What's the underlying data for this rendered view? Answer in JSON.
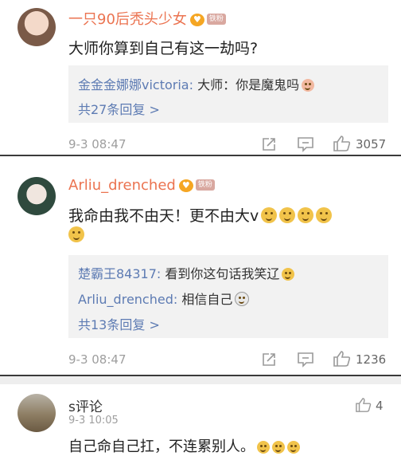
{
  "comments": [
    {
      "name": "一只90后秃头少女",
      "badge": "铁粉",
      "text": "大师你算到自己有这一劫吗?",
      "replies": [
        {
          "name": "金金金娜娜victoria:",
          "text": " 大师：你是魔鬼吗"
        }
      ],
      "more": "共27条回复 >",
      "time": "9-3 08:47",
      "likes": "3057"
    },
    {
      "name": "Arliu_drenched",
      "badge": "铁粉",
      "text_line1": "我命由我不由天！更不由大v",
      "text_line2": "",
      "replies": [
        {
          "name": "楚霸王84317:",
          "text": " 看到你这句话我笑辽"
        },
        {
          "name": "Arliu_drenched:",
          "text": " 相信自己"
        }
      ],
      "more": "共13条回复 >",
      "time": "9-3 08:47",
      "likes": "1236"
    },
    {
      "name": "s评论",
      "time": "9-3 10:05",
      "text": "自己命自己扛，不连累别人。",
      "likes": "4"
    }
  ],
  "icons": [
    "share-icon",
    "comment-icon",
    "like-icon"
  ]
}
